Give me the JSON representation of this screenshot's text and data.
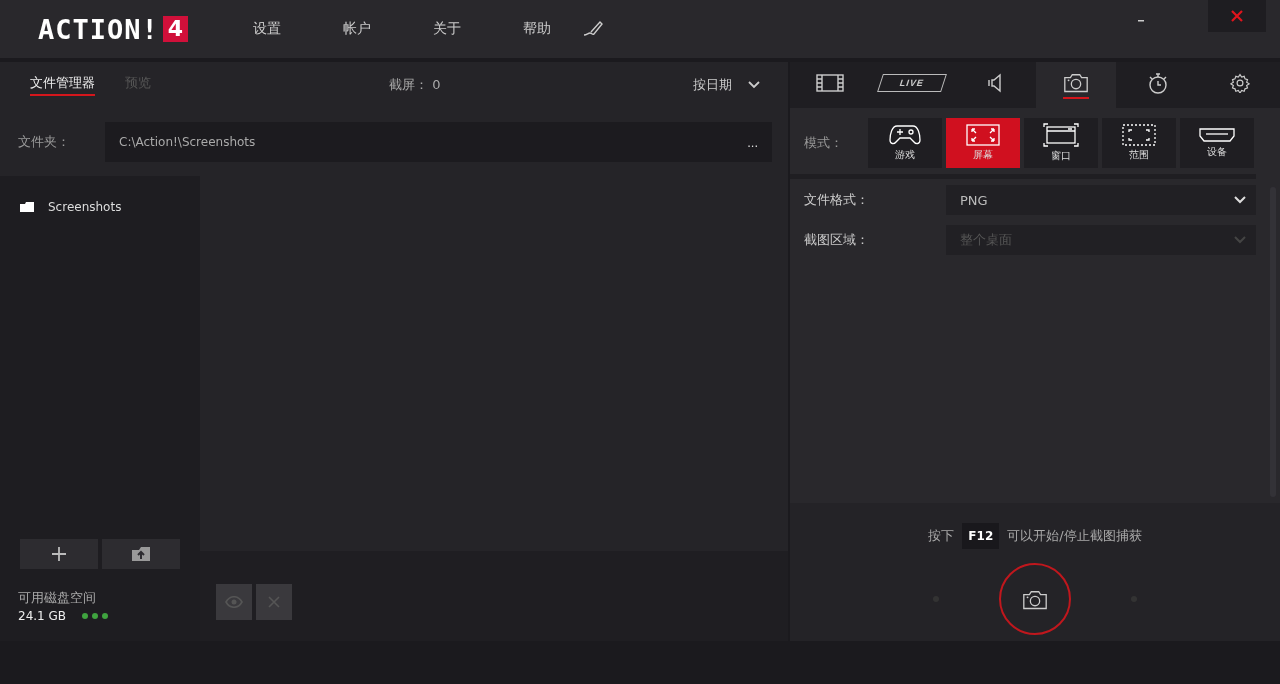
{
  "app": {
    "logo": "ACTION!",
    "logo_badge": "4"
  },
  "menu": [
    {
      "label": "设置"
    },
    {
      "label": "帐户"
    },
    {
      "label": "关于"
    },
    {
      "label": "帮助"
    }
  ],
  "file_manager": {
    "tabs": [
      {
        "label": "文件管理器",
        "selected": true
      },
      {
        "label": "预览",
        "selected": false
      }
    ],
    "count": "截屏： 0",
    "sort": "按日期",
    "folder_label": "文件夹：",
    "folder_path": "C:\\Action!\\Screenshots",
    "folder_more": "...",
    "tree": [
      {
        "label": "Screenshots",
        "selected": false
      }
    ],
    "disk_label": "可用磁盘空间",
    "disk_value": "24.1 GB"
  },
  "panel_tabs": [
    {
      "kind": "video",
      "selected": false
    },
    {
      "kind": "live",
      "label": "LIVE",
      "selected": false
    },
    {
      "kind": "audio",
      "selected": false
    },
    {
      "kind": "screenshot",
      "selected": true
    },
    {
      "kind": "timer",
      "selected": false
    },
    {
      "kind": "settings",
      "selected": false
    }
  ],
  "mode": {
    "label": "模式：",
    "options": [
      {
        "kind": "game",
        "label": "游戏",
        "selected": false
      },
      {
        "kind": "screen",
        "label": "屏幕",
        "selected": true
      },
      {
        "kind": "window",
        "label": "窗口",
        "selected": false
      },
      {
        "kind": "region",
        "label": "范围",
        "selected": false
      },
      {
        "kind": "device",
        "label": "设备",
        "selected": false
      }
    ]
  },
  "settings": [
    {
      "label": "文件格式：",
      "value": "PNG",
      "disabled": false
    },
    {
      "label": "截图区域：",
      "value": "整个桌面",
      "disabled": true
    }
  ],
  "hint": {
    "before": "按下",
    "key": "F12",
    "after": "可以开始/停止截图捕获"
  }
}
